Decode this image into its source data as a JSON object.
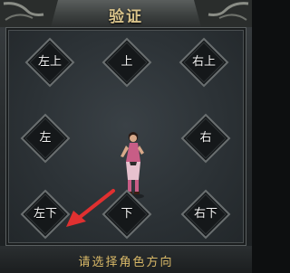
{
  "window": {
    "title": "验证",
    "instruction": "请选择角色方向"
  },
  "directions": [
    {
      "id": "up-left",
      "label": "左上"
    },
    {
      "id": "up",
      "label": "上"
    },
    {
      "id": "up-right",
      "label": "右上"
    },
    {
      "id": "left",
      "label": "左"
    },
    {
      "id": "right",
      "label": "右"
    },
    {
      "id": "down-left",
      "label": "左下"
    },
    {
      "id": "down",
      "label": "下"
    },
    {
      "id": "down-right",
      "label": "右下"
    }
  ],
  "colors": {
    "title_gold": "#d9c38a",
    "instruction_gold": "#d9b968",
    "button_fill": "#1a1d1f",
    "button_border": "#6a6f70",
    "arrow_red": "#e03030"
  },
  "icons": {
    "pointer": "red-arrow-icon",
    "character": "character-sprite"
  }
}
